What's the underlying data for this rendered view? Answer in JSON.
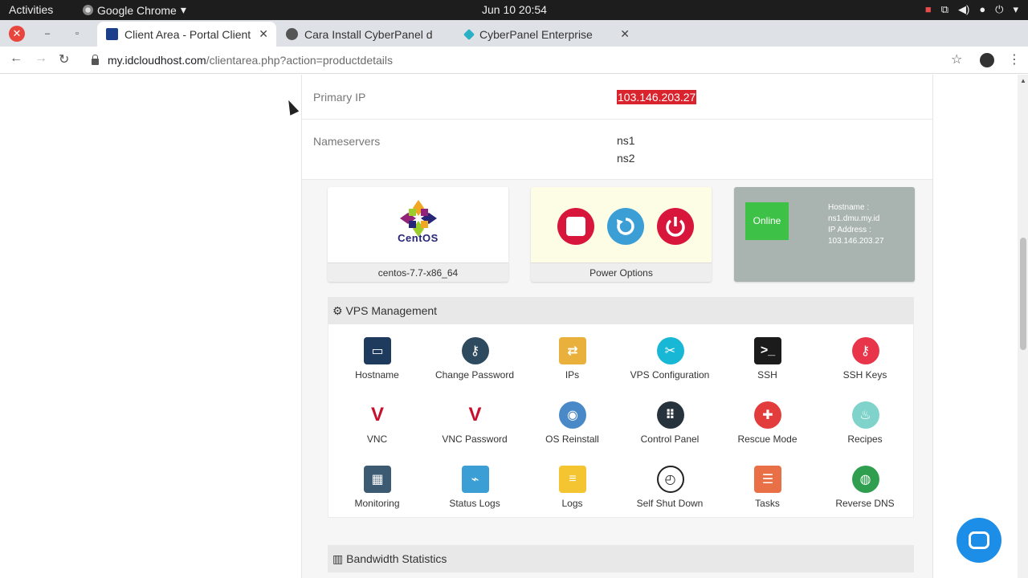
{
  "topbar": {
    "activities": "Activities",
    "app_name": "Google Chrome",
    "clock": "Jun 10  20:54"
  },
  "tabs": [
    {
      "title": "Client Area - Portal Client",
      "active": true
    },
    {
      "title": "Cara Install CyberPanel d",
      "active": false
    },
    {
      "title": "CyberPanel Enterprise",
      "active": false
    }
  ],
  "address": {
    "host": "my.idcloudhost.com",
    "path": "/clientarea.php?action=productdetails"
  },
  "info": {
    "primary_ip_label": "Primary IP",
    "primary_ip_value": "103.146.203.27",
    "nameservers_label": "Nameservers",
    "ns1": "ns1",
    "ns2": "ns2"
  },
  "os_card": {
    "logo_text": "CentOS",
    "footer": "centos-7.7-x86_64"
  },
  "power_card": {
    "footer": "Power Options"
  },
  "status_card": {
    "status": "Online",
    "hostname_label": "Hostname :",
    "hostname": "ns1.dmu.my.id",
    "ip_label": "IP Address :",
    "ip": "103.146.203.27"
  },
  "vps_management": {
    "title": "VPS Management",
    "tiles": [
      {
        "label": "Hostname",
        "icon": "monitor-icon",
        "color": "#1e3a5c"
      },
      {
        "label": "Change Password",
        "icon": "key-icon",
        "color": "#2e4a5f"
      },
      {
        "label": "IPs",
        "icon": "network-icon",
        "color": "#e9b13c"
      },
      {
        "label": "VPS Configuration",
        "icon": "tools-icon",
        "color": "#18b7d6"
      },
      {
        "label": "SSH",
        "icon": "terminal-icon",
        "color": "#1b1b1b"
      },
      {
        "label": "SSH Keys",
        "icon": "ssh-key-icon",
        "color": "#e8354a"
      },
      {
        "label": "VNC",
        "icon": "vnc-icon",
        "color": "#c8102e"
      },
      {
        "label": "VNC Password",
        "icon": "vnc-key-icon",
        "color": "#c8102e"
      },
      {
        "label": "OS Reinstall",
        "icon": "disc-icon",
        "color": "#4a89c8"
      },
      {
        "label": "Control Panel",
        "icon": "control-panel-icon",
        "color": "#26333d"
      },
      {
        "label": "Rescue Mode",
        "icon": "lifebuoy-icon",
        "color": "#e23c3c"
      },
      {
        "label": "Recipes",
        "icon": "chef-hat-icon",
        "color": "#7fd3cb"
      },
      {
        "label": "Monitoring",
        "icon": "monitoring-icon",
        "color": "#3d5a73"
      },
      {
        "label": "Status Logs",
        "icon": "status-chart-icon",
        "color": "#3b9fd6"
      },
      {
        "label": "Logs",
        "icon": "notepad-icon",
        "color": "#f4c431"
      },
      {
        "label": "Self Shut Down",
        "icon": "timer-icon",
        "color": "#ffffff"
      },
      {
        "label": "Tasks",
        "icon": "clipboard-icon",
        "color": "#e96f46"
      },
      {
        "label": "Reverse DNS",
        "icon": "globe-icon",
        "color": "#2f9e4f"
      }
    ]
  },
  "bandwidth": {
    "title": "Bandwidth Statistics"
  }
}
